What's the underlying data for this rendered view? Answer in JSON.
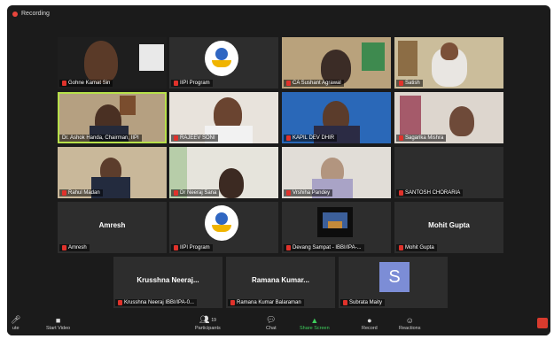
{
  "header": {
    "recording_label": "Recording"
  },
  "tiles": [
    {
      "name": "Gohne Kamat Sin"
    },
    {
      "name": "IIPI Program"
    },
    {
      "name": "CA Sushant Agrawal"
    },
    {
      "name": "Satish"
    },
    {
      "name": "Dr. Ashok Handa, Chairman, IIPI"
    },
    {
      "name": "RAJEEV SONI"
    },
    {
      "name": "KAPIL DEV DHIR"
    },
    {
      "name": "Sagarika Mishra"
    },
    {
      "name": "Rahul Madan"
    },
    {
      "name": "Dr Neeraj Sana"
    },
    {
      "name": "Vrshiha Pandey"
    },
    {
      "name": "SANTOSH CHORARIA"
    },
    {
      "name": "Amresh",
      "display": "Amresh"
    },
    {
      "name": "IIPI Program"
    },
    {
      "name": "Devang Sampat - IBBI/IPA-..."
    },
    {
      "name": "Mohit Gupta",
      "display": "Mohit Gupta"
    },
    {
      "name": "Krusshna Neeraj IBBI/IPA-0...",
      "display": "Krusshna Neeraj..."
    },
    {
      "name": "Ramana Kumar Balaraman",
      "display": "Ramana Kumar..."
    },
    {
      "name": "Subrata Maity",
      "avatar": "S"
    }
  ],
  "toolbar": {
    "mute": "ute",
    "start_video": "Start Video",
    "participants": "Participants",
    "participants_count": "19",
    "chat": "Chat",
    "share_screen": "Share Screen",
    "record": "Record",
    "reactions": "Reactions"
  },
  "colors": {
    "active_speaker": "#b7e04a",
    "mic_muted": "#e0322b",
    "share_green": "#3ecf5c",
    "end": "#d83b2e"
  }
}
